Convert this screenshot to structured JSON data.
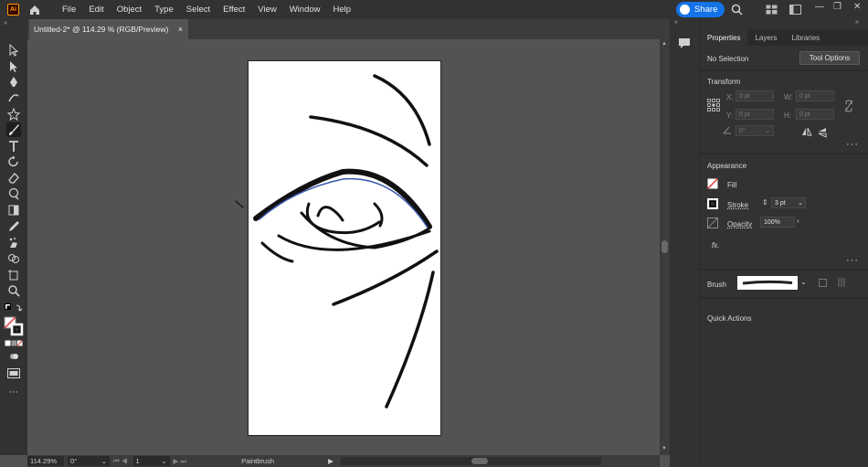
{
  "app": {
    "logo": "Ai",
    "menu": [
      "File",
      "Edit",
      "Object",
      "Type",
      "Select",
      "Effect",
      "View",
      "Window",
      "Help"
    ],
    "share_label": "Share"
  },
  "document": {
    "tab_title": "Untitled-2* @ 114.29 % (RGB/Preview)",
    "close": "×"
  },
  "statusbar": {
    "zoom": "114.29%",
    "rotation": "0°",
    "artboard_num": "1",
    "tool_name": "Paintbrush"
  },
  "panel": {
    "tabs": [
      "Properties",
      "Layers",
      "Libraries"
    ],
    "selection_status": "No Selection",
    "tool_options_label": "Tool Options",
    "transform": {
      "title": "Transform",
      "x_label": "X:",
      "y_label": "Y:",
      "w_label": "W:",
      "h_label": "H:",
      "x_value": "0 pt",
      "y_value": "0 pt",
      "w_value": "0 pt",
      "h_value": "0 pt",
      "angle_value": "0°"
    },
    "appearance": {
      "title": "Appearance",
      "fill_label": "Fill",
      "stroke_label": "Stroke",
      "stroke_value": "3 pt",
      "opacity_label": "Opacity",
      "opacity_value": "100%",
      "fx_label": "fx."
    },
    "brush_label": "Brush",
    "quick_actions_label": "Quick Actions"
  },
  "colors": {
    "accent": "#1473e6",
    "selection_path": "#3a5ab0",
    "none_swatch": "#e53935"
  }
}
